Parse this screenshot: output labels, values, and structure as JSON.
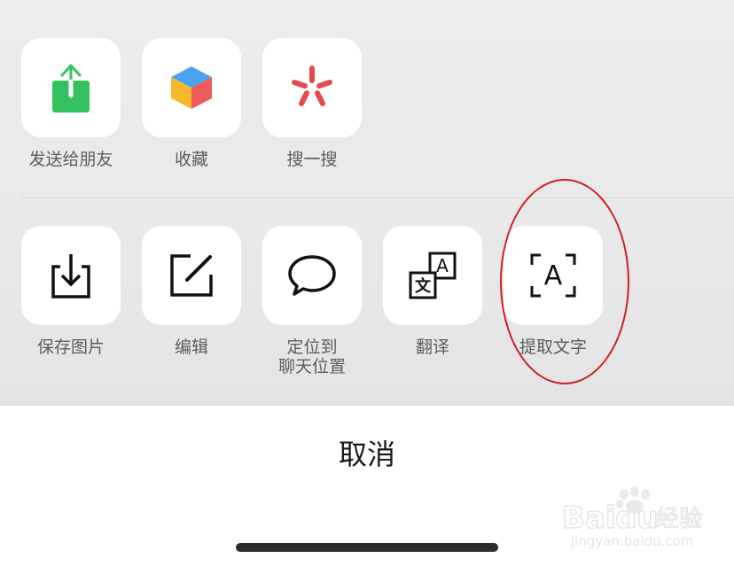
{
  "share_row": [
    {
      "id": "send",
      "label": "发送给朋友"
    },
    {
      "id": "favorite",
      "label": "收藏"
    },
    {
      "id": "search",
      "label": "搜一搜"
    }
  ],
  "action_row": [
    {
      "id": "save",
      "label": "保存图片"
    },
    {
      "id": "edit",
      "label": "编辑"
    },
    {
      "id": "locate",
      "label": "定位到\n聊天位置"
    },
    {
      "id": "translate",
      "label": "翻译"
    },
    {
      "id": "extract",
      "label": "提取文字"
    }
  ],
  "cancel_label": "取消",
  "watermark": {
    "brand": "Baidu经验",
    "site": "jingyan.baidu.com"
  },
  "colors": {
    "send_green": "#34c25f",
    "annotation_red": "#d11f1f",
    "search_red": "#e5484d"
  }
}
